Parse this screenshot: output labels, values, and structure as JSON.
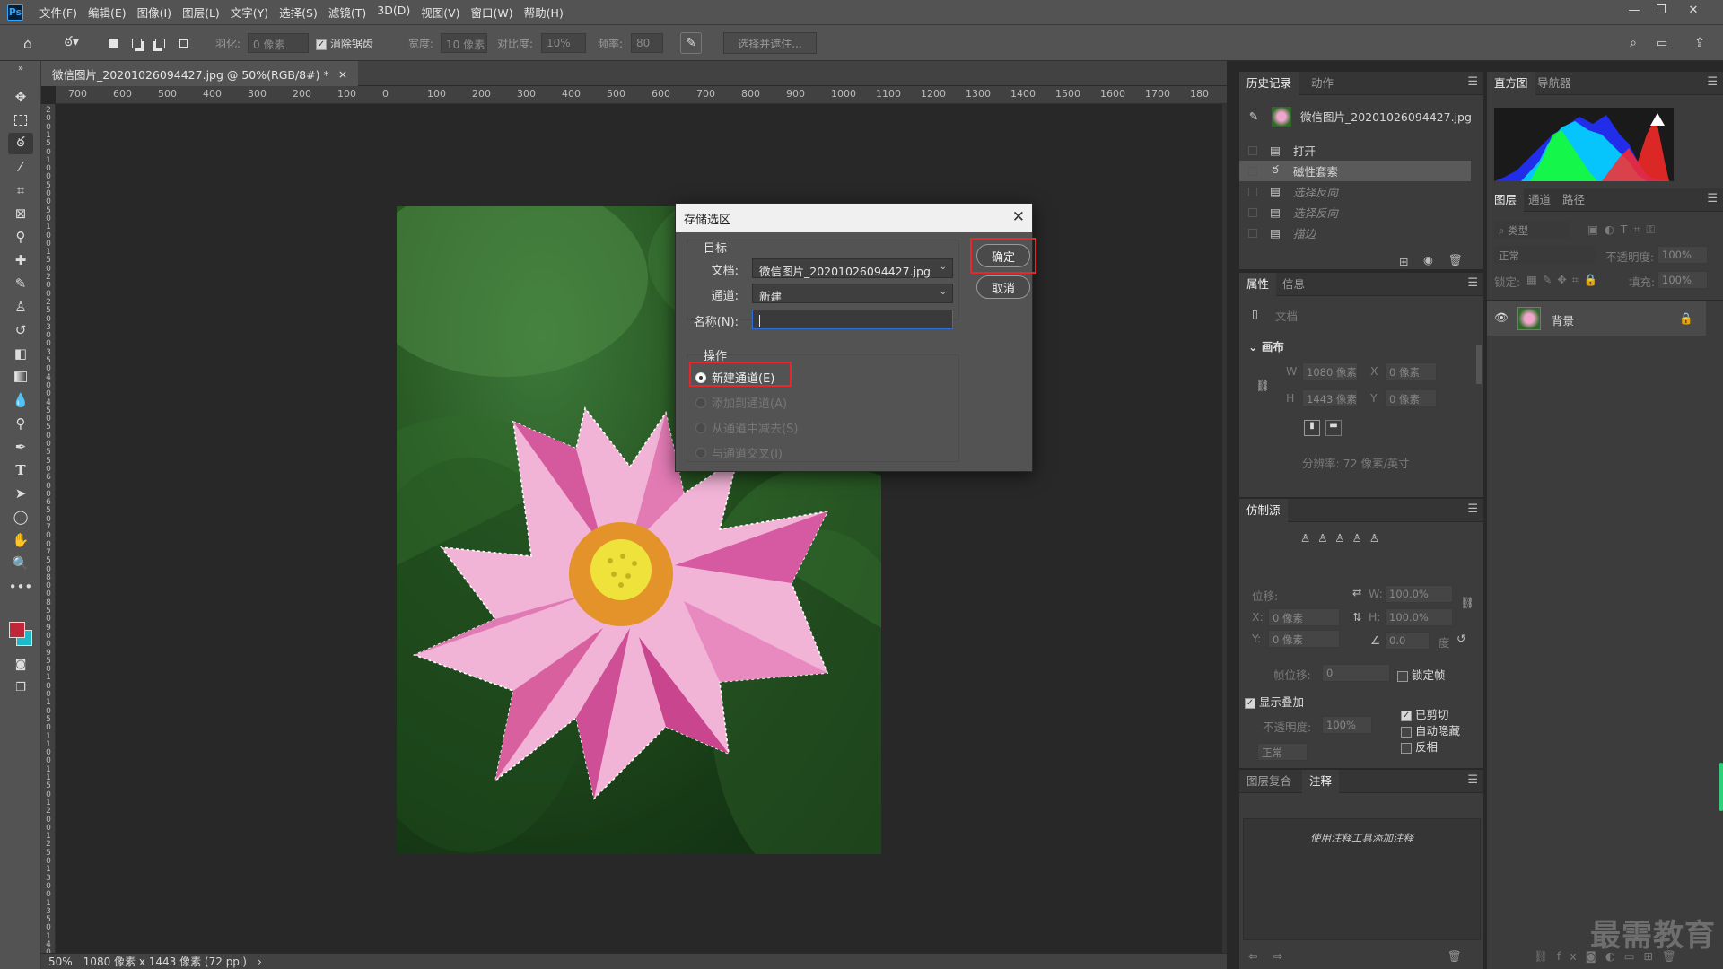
{
  "app": {
    "logo": "Ps"
  },
  "menu": [
    "文件(F)",
    "编辑(E)",
    "图像(I)",
    "图层(L)",
    "文字(Y)",
    "选择(S)",
    "滤镜(T)",
    "3D(D)",
    "视图(V)",
    "窗口(W)",
    "帮助(H)"
  ],
  "window_controls": {
    "minimize": "—",
    "restore": "❐",
    "close": "✕"
  },
  "options": {
    "feather_label": "羽化:",
    "feather_value": "0 像素",
    "antialias_label": "消除锯齿",
    "width_label": "宽度:",
    "width_value": "10 像素",
    "contrast_label": "对比度:",
    "contrast_value": "10%",
    "frequency_label": "频率:",
    "frequency_value": "80",
    "select_mask": "选择并遮住..."
  },
  "document": {
    "tab_title": "微信图片_20201026094427.jpg @ 50%(RGB/8#) *",
    "tab_close": "×",
    "status_zoom": "50%",
    "status_info": "1080 像素 x 1443 像素 (72 ppi)",
    "status_arrow": "›"
  },
  "ruler_h": [
    "700",
    "600",
    "500",
    "400",
    "300",
    "200",
    "100",
    "0",
    "100",
    "200",
    "300",
    "400",
    "500",
    "600",
    "700",
    "800",
    "900",
    "1000",
    "1100",
    "1200",
    "1300",
    "1400",
    "1500",
    "1600",
    "1700",
    "180"
  ],
  "ruler_v": [
    "2",
    "0",
    "0",
    "1",
    "5",
    "0",
    "1",
    "0",
    "0",
    "5",
    "0",
    "0",
    "5",
    "0",
    "1",
    "0",
    "0",
    "1",
    "5",
    "0",
    "2",
    "0",
    "0",
    "2",
    "5",
    "0",
    "3",
    "0",
    "0",
    "3",
    "5",
    "0",
    "4",
    "0",
    "0",
    "4",
    "5",
    "0",
    "5",
    "0",
    "0",
    "5",
    "5",
    "0",
    "6",
    "0",
    "0",
    "6",
    "5",
    "0",
    "7",
    "0",
    "0",
    "7",
    "5",
    "0",
    "8",
    "0",
    "0",
    "8",
    "5",
    "0",
    "9",
    "0",
    "0",
    "9",
    "5",
    "0",
    "1",
    "0",
    "0",
    "1",
    "0",
    "5",
    "0",
    "1",
    "1",
    "0",
    "0",
    "1",
    "1",
    "5",
    "0",
    "1",
    "2",
    "0",
    "0",
    "1",
    "2",
    "5",
    "0",
    "1",
    "3",
    "0",
    "0",
    "1",
    "3",
    "5",
    "0",
    "1",
    "4",
    "0",
    "0"
  ],
  "dialog": {
    "title": "存储选区",
    "close": "✕",
    "target_group": "目标",
    "doc_label": "文档:",
    "doc_value": "微信图片_20201026094427.jpg",
    "channel_label": "通道:",
    "channel_value": "新建",
    "name_label": "名称(N):",
    "name_value": "",
    "ok": "确定",
    "cancel": "取消",
    "op_group": "操作",
    "ops": [
      {
        "label": "新建通道(E)",
        "selected": true,
        "enabled": true
      },
      {
        "label": "添加到通道(A)",
        "selected": false,
        "enabled": false
      },
      {
        "label": "从通道中减去(S)",
        "selected": false,
        "enabled": false
      },
      {
        "label": "与通道交叉(I)",
        "selected": false,
        "enabled": false
      }
    ],
    "highlight_color": "#e8262d"
  },
  "history_panel": {
    "tabs": [
      "历史记录",
      "动作"
    ],
    "snapshot": "微信图片_20201026094427.jpg",
    "items": [
      {
        "label": "打开",
        "state": "normal"
      },
      {
        "label": "磁性套索",
        "state": "active"
      },
      {
        "label": "选择反向",
        "state": "undone"
      },
      {
        "label": "选择反向",
        "state": "undone"
      },
      {
        "label": "描边",
        "state": "undone"
      }
    ]
  },
  "properties_panel": {
    "tabs": [
      "属性",
      "信息"
    ],
    "doc_label": "文档",
    "canvas_section": "画布",
    "w_label": "W",
    "w_value": "1080 像素",
    "h_label": "H",
    "h_value": "1443 像素",
    "x_label": "X",
    "x_value": "0 像素",
    "y_label": "Y",
    "y_value": "0 像素",
    "resolution": "分辨率: 72 像素/英寸"
  },
  "clone_panel": {
    "tab": "仿制源",
    "offset_label": "位移:",
    "x_label": "X:",
    "x_value": "0 像素",
    "y_label": "Y:",
    "y_value": "0 像素",
    "w_label": "W:",
    "w_value": "100.0%",
    "h_label": "H:",
    "h_value": "100.0%",
    "angle_value": "0.0",
    "angle_unit": "度",
    "frame_offset_label": "帧位移:",
    "frame_offset_value": "0",
    "lock_frame": "锁定帧",
    "show_overlay": "显示叠加",
    "opacity_label": "不透明度:",
    "opacity_value": "100%",
    "blend": "正常",
    "clipped": "已剪切",
    "auto_hide": "自动隐藏",
    "invert": "反相"
  },
  "notes_panel": {
    "tabs": [
      "图层复合",
      "注释"
    ],
    "hint": "使用注释工具添加注释"
  },
  "histogram_panel": {
    "tabs": [
      "直方图",
      "导航器"
    ]
  },
  "layers_panel": {
    "tabs": [
      "图层",
      "通道",
      "路径"
    ],
    "filter_placeholder": "类型",
    "blend_mode": "正常",
    "opacity_label": "不透明度:",
    "opacity_value": "100%",
    "lock_label": "锁定:",
    "fill_label": "填充:",
    "fill_value": "100%",
    "layer_name": "背景"
  },
  "colors": {
    "foreground": "#c0283a",
    "background": "#1fb8c8",
    "accent": "#31a8ff"
  },
  "watermark": "最需教育"
}
